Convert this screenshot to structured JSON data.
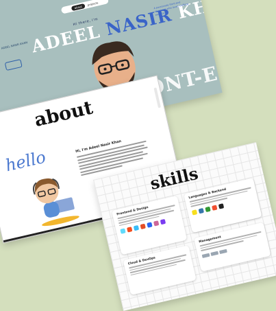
{
  "hero": {
    "nav": {
      "active": "about",
      "item": "projects"
    },
    "logo": "ADEEL NASIR KHAN",
    "greeting": "Hi there, i'm",
    "name": {
      "first": "ADEEL",
      "middle": "NASIR",
      "last": "KHAN"
    },
    "description": "A passionate front-end developer who loves crafting websites",
    "marquee": "ONT-END - FRONT-END - FR"
  },
  "about": {
    "title": "about",
    "hello": "hello",
    "heading": "Hi, I'm Adeel Nasir Khan"
  },
  "skills": {
    "title": "skills",
    "cards": {
      "frontend": "Frontend & Design",
      "languages": "Languages & Backend",
      "cloud": "Cloud & DevOps",
      "management": "Management"
    }
  },
  "colors": {
    "page_bg": "#d4dfbd",
    "hero_bg": "#a8bfbe",
    "accent_blue": "#3a64c8"
  }
}
